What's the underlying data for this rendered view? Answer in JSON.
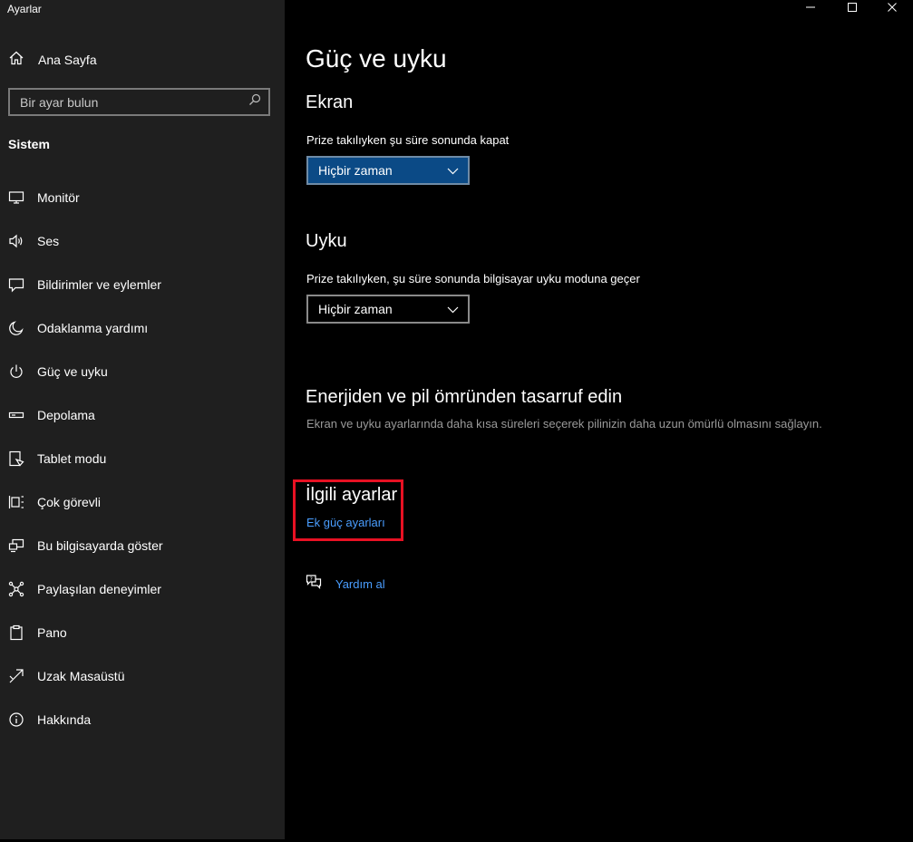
{
  "app": {
    "title": "Ayarlar"
  },
  "sidebar": {
    "home_label": "Ana Sayfa",
    "search_placeholder": "Bir ayar bulun",
    "section": "Sistem",
    "items": [
      {
        "label": "Monitör",
        "icon": "monitor-icon"
      },
      {
        "label": "Ses",
        "icon": "speaker-icon"
      },
      {
        "label": "Bildirimler ve eylemler",
        "icon": "notification-icon"
      },
      {
        "label": "Odaklanma yardımı",
        "icon": "moon-icon"
      },
      {
        "label": "Güç ve uyku",
        "icon": "power-icon"
      },
      {
        "label": "Depolama",
        "icon": "storage-icon"
      },
      {
        "label": "Tablet modu",
        "icon": "tablet-icon"
      },
      {
        "label": "Çok görevli",
        "icon": "multitask-icon"
      },
      {
        "label": "Bu bilgisayarda göster",
        "icon": "project-icon"
      },
      {
        "label": "Paylaşılan deneyimler",
        "icon": "share-icon"
      },
      {
        "label": "Pano",
        "icon": "clipboard-icon"
      },
      {
        "label": "Uzak Masaüstü",
        "icon": "remote-icon"
      },
      {
        "label": "Hakkında",
        "icon": "info-icon"
      }
    ]
  },
  "main": {
    "title": "Güç ve uyku",
    "screen": {
      "heading": "Ekran",
      "label": "Prize takılıyken şu süre sonunda kapat",
      "value": "Hiçbir zaman"
    },
    "sleep": {
      "heading": "Uyku",
      "label": "Prize takılıyken, şu süre sonunda bilgisayar uyku moduna geçer",
      "value": "Hiçbir zaman"
    },
    "energy": {
      "heading": "Enerjiden ve pil ömründen tasarruf edin",
      "description": "Ekran ve uyku ayarlarında daha kısa süreleri seçerek pilinizin daha uzun ömürlü olmasını sağlayın."
    },
    "related": {
      "heading": "İlgili ayarlar",
      "link": "Ek güç ayarları"
    },
    "help_link": "Yardım al"
  },
  "colors": {
    "accent": "#4a9eff",
    "selected_dropdown": "#0b4a86",
    "highlight_box": "#e81123"
  }
}
